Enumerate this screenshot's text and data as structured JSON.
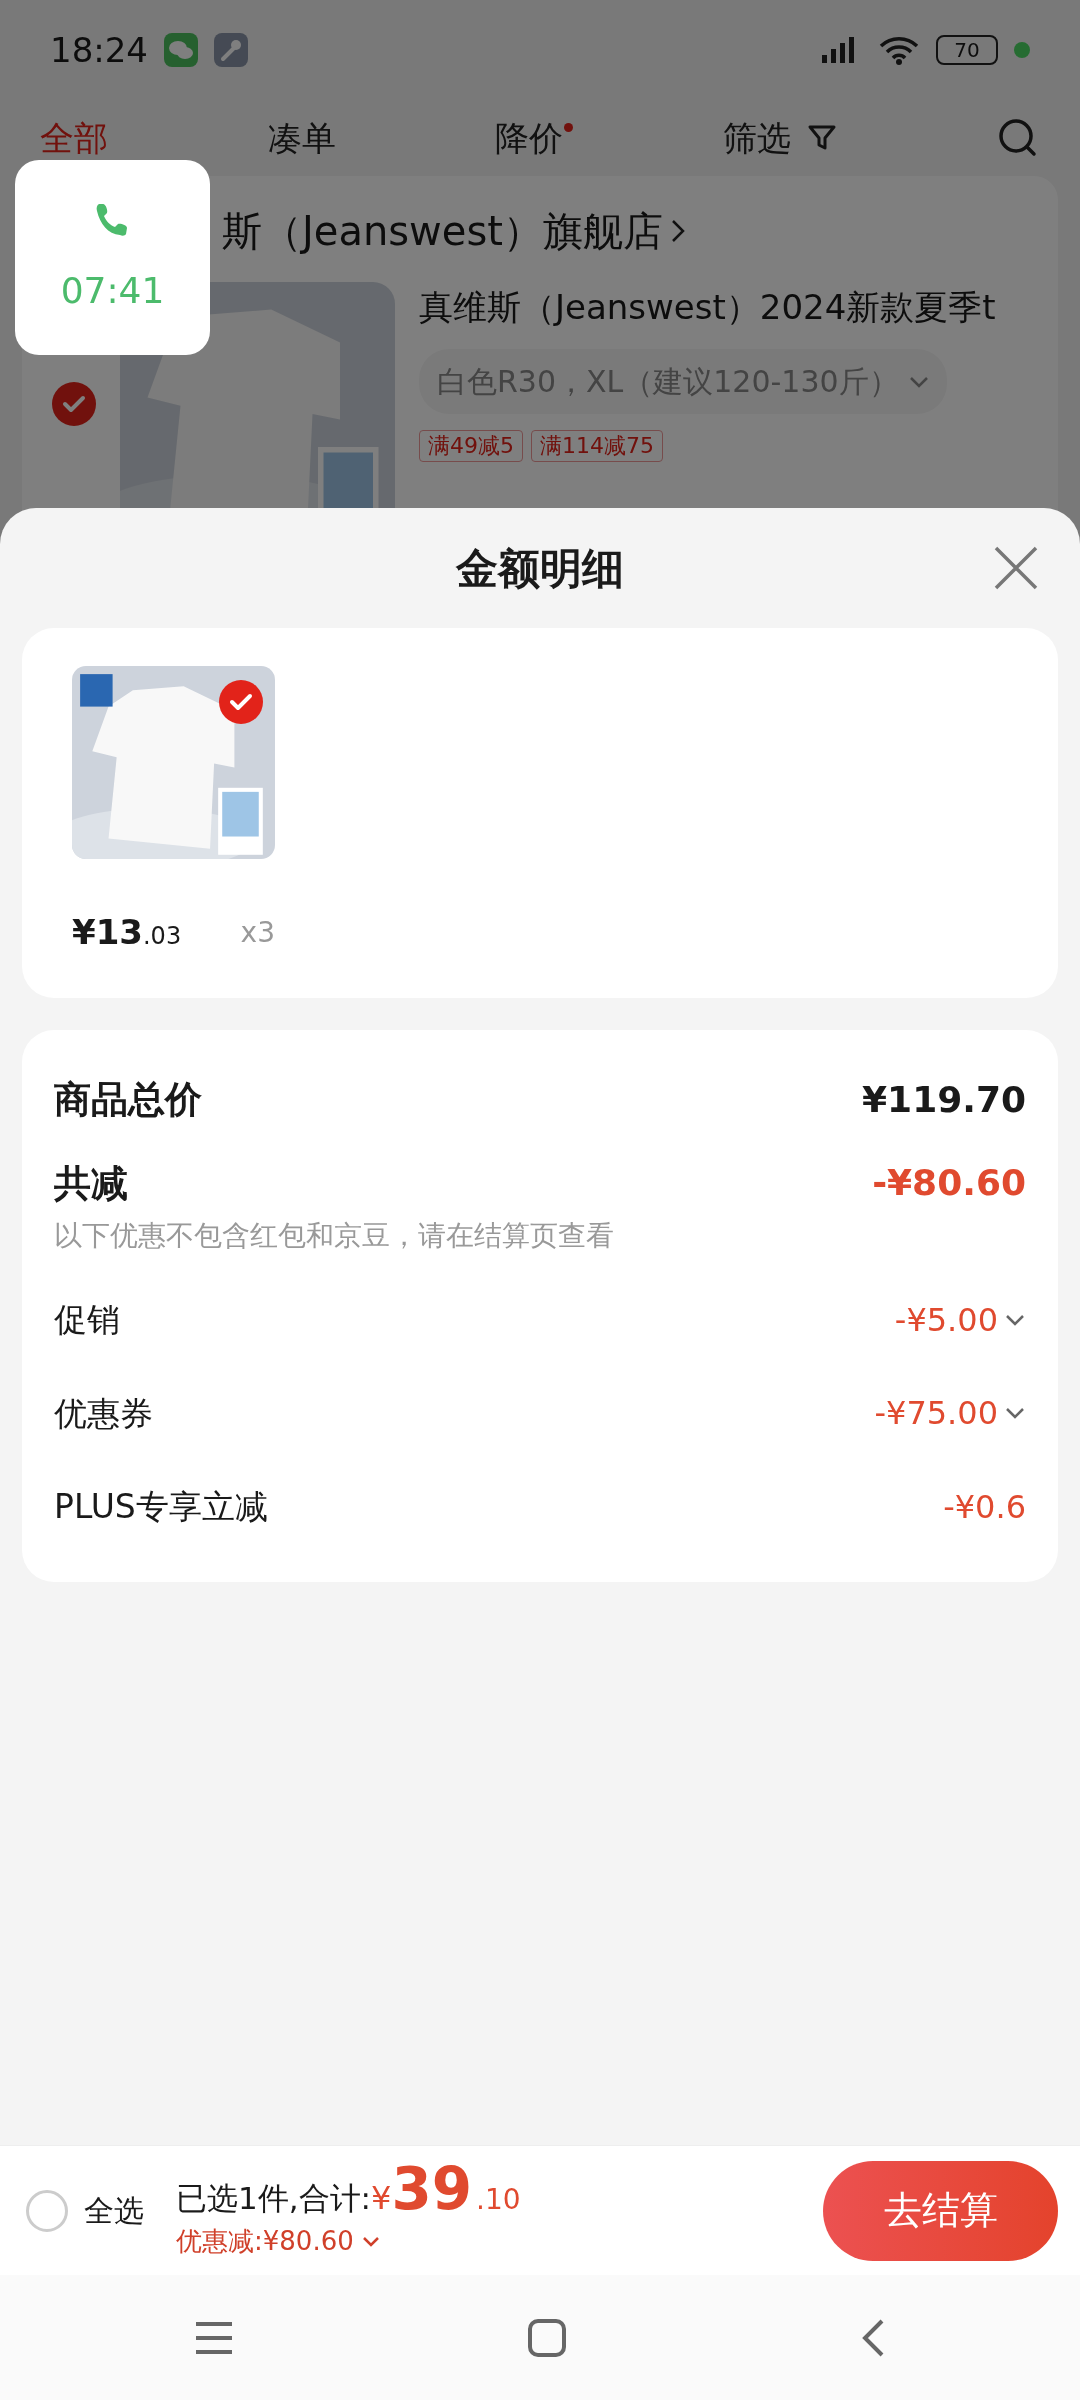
{
  "status_bar": {
    "time": "18:24",
    "battery": "70"
  },
  "tabs": [
    {
      "label": "全部",
      "selected": true,
      "dot": false,
      "kind": "plain"
    },
    {
      "label": "凑单",
      "selected": false,
      "dot": false,
      "kind": "plain"
    },
    {
      "label": "降价",
      "selected": false,
      "dot": true,
      "kind": "plain"
    },
    {
      "label": "筛选",
      "selected": false,
      "dot": false,
      "kind": "filter"
    }
  ],
  "call_widget": {
    "duration": "07:41"
  },
  "cart": {
    "store_name": "斯（Jeanswest）旗舰店",
    "item": {
      "checked": true,
      "title": "真维斯（Jeanswest）2024新款夏季t",
      "variant": "白色R30，XL（建议120-130斤）",
      "tags": [
        "满49减5",
        "满114减75"
      ]
    }
  },
  "sheet": {
    "title": "金额明细",
    "items": [
      {
        "checked": true,
        "price_main": "¥13",
        "price_cents": ".03",
        "quantity": "x3"
      }
    ],
    "summary": [
      {
        "kind": "total",
        "label": "商品总价",
        "value": "¥119.70"
      },
      {
        "kind": "discount_total",
        "label": "共减",
        "value": "-¥80.60",
        "note": "以下优惠不包含红包和京豆，请在结算页查看"
      },
      {
        "kind": "discount",
        "label": "促销",
        "value": "-¥5.00",
        "expandable": true
      },
      {
        "kind": "discount",
        "label": "优惠券",
        "value": "-¥75.00",
        "expandable": true
      },
      {
        "kind": "discount",
        "label": "PLUS专享立减",
        "value": "-¥0.6",
        "expandable": false
      }
    ]
  },
  "footer": {
    "select_all_label": "全选",
    "select_all_checked": false,
    "selected_summary": "已选1件,合计:",
    "currency": "¥",
    "total_main": "39",
    "total_cents": ".10",
    "discount": "优惠减:¥80.60",
    "checkout": "去结算"
  }
}
